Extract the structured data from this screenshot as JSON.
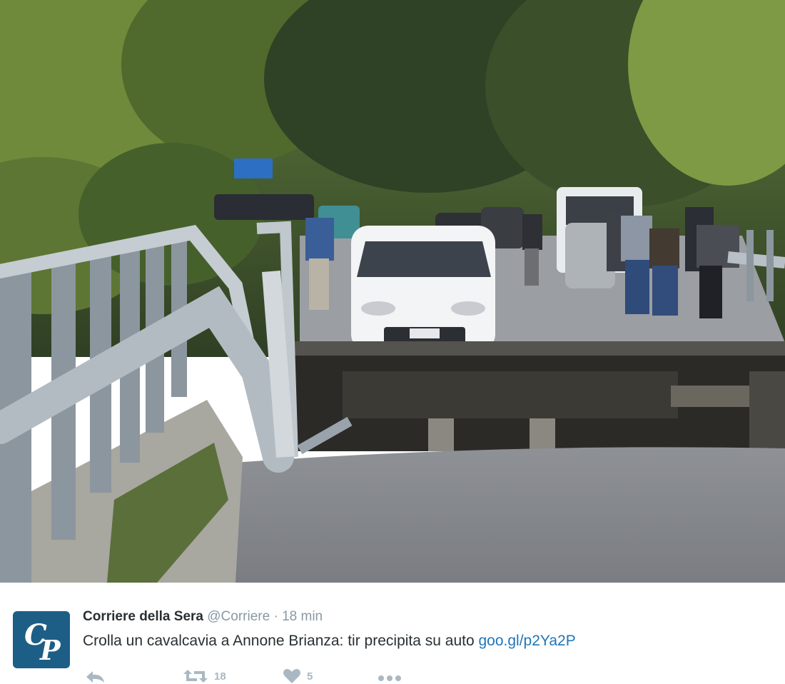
{
  "tweet": {
    "author_name": "Corriere della Sera",
    "handle": "@Corriere",
    "separator": "·",
    "time": "18 min",
    "text": "Crolla un cavalcavia a Annone Brianza: tir precipita su auto ",
    "link_text": "goo.gl/p2Ya2P",
    "retweet_count": "18",
    "like_count": "5"
  },
  "avatar": {
    "logo_text_top": "C",
    "logo_text_bottom": "P",
    "color": "#1d5e86"
  },
  "icons": {
    "reply": "reply-icon",
    "retweet": "retweet-icon",
    "like": "heart-icon",
    "more": "more-icon"
  },
  "colors": {
    "link": "#1f76b8",
    "muted": "#8899a6",
    "text": "#292f33",
    "action": "#aab8c2"
  }
}
